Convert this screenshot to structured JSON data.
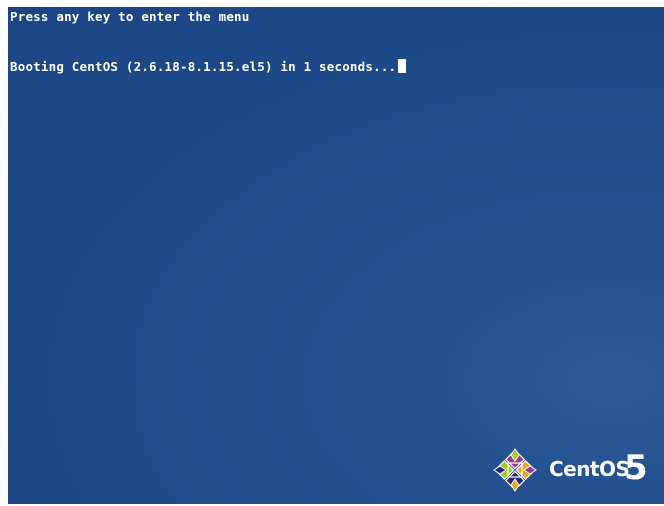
{
  "console": {
    "prompt_line": "Press any key to enter the menu",
    "boot_line": "Booting CentOS (2.6.18-8.1.15.el5) in 1 seconds..."
  },
  "logo": {
    "brand_text": "CentOS",
    "version_text": "5",
    "icon": "centos-logo-icon"
  },
  "colors": {
    "background": "#1e4a8a",
    "text": "#ffffff",
    "logo_purple": "#9b3c8f",
    "logo_green": "#9ccd2a",
    "logo_yellow": "#efa724",
    "logo_blue": "#262577"
  }
}
